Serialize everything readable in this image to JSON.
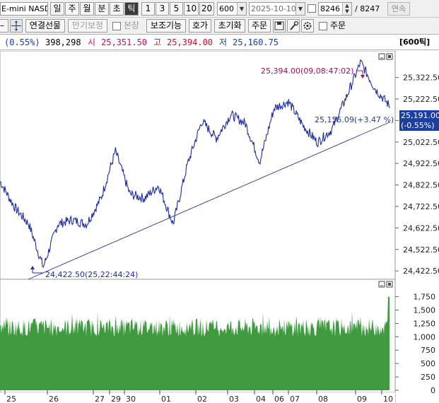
{
  "toolbar": {
    "symbol": "E-mini NASDA",
    "period_buttons": [
      "일",
      "주",
      "월",
      "분",
      "초",
      "틱"
    ],
    "active_period": "틱",
    "number_buttons": [
      "1",
      "3",
      "5",
      "10",
      "20"
    ],
    "interval_value": "600",
    "date_value": "2025-10-10",
    "count_value": "8246",
    "count_total": "/ 8247",
    "continuous_label": "연속"
  },
  "toolbar2": {
    "combined_futures": "연결선물",
    "expiry_bojeong": "만기보정",
    "bonjang_label": "본장",
    "indicator_btn": "보조기능",
    "hoga_btn": "호가",
    "init_btn": "초기화",
    "order_btn": "주문",
    "order_check_label": "주문"
  },
  "info": {
    "change_pct": "(0.55%)",
    "volume": "398,298",
    "open_label": "시",
    "open_value": "25,351.50",
    "high_label": "고",
    "high_value": "25,394.00",
    "low_label": "저",
    "low_value": "25,160.75",
    "period_label": "[600틱]"
  },
  "chart_data": [
    {
      "type": "line",
      "series": [
        {
          "x": [
            "25",
            "25",
            "26",
            "26",
            "26",
            "26",
            "27",
            "29",
            "30",
            "30",
            "01",
            "01",
            "01",
            "02",
            "02",
            "03",
            "03",
            "04",
            "04",
            "06",
            "07",
            "07",
            "08",
            "08",
            "09",
            "09",
            "10",
            "10"
          ],
          "values": [
            24840,
            24720,
            24640,
            24440,
            24640,
            24660,
            24640,
            24760,
            24980,
            24780,
            24760,
            24820,
            24640,
            24920,
            25120,
            25040,
            25150,
            25110,
            24930,
            25180,
            25210,
            25100,
            25020,
            25080,
            25230,
            25394,
            25270,
            25191
          ]
        }
      ],
      "yticks": [
        "25,322.50",
        "25,222.50",
        "25,122.50",
        "25,022.50",
        "24,922.50",
        "24,822.50",
        "24,722.50",
        "24,622.50",
        "24,522.50",
        "24,422.50"
      ],
      "ylim": [
        24400,
        25420
      ],
      "annotations": {
        "high_marker": "25,394.00(09,08:47:02)",
        "low_marker": "24,422.50(25,22:44:24)",
        "trendline_label": "25,155.09(+3.47 %)"
      },
      "last_price": "25,191.00",
      "last_change": "(-0.55%)",
      "xticks": [
        "25",
        "26",
        "27",
        "29",
        "30",
        "01",
        "02",
        "03",
        "04",
        "06",
        "07",
        "08",
        "09",
        "10"
      ]
    },
    {
      "type": "bar",
      "name": "volume",
      "yticks": [
        "1,750",
        "1,500",
        "1,250",
        "1,000",
        "750",
        "500",
        "250",
        "0"
      ],
      "ylim": [
        0,
        1850
      ],
      "typical_range": [
        1000,
        1350
      ],
      "last_value": 1750
    }
  ],
  "colors": {
    "price_line": "#1f2f9c",
    "volume_fill": "#3f9a40",
    "trendline": "#2a3a90",
    "last_price_box": "#1a3fa3"
  }
}
